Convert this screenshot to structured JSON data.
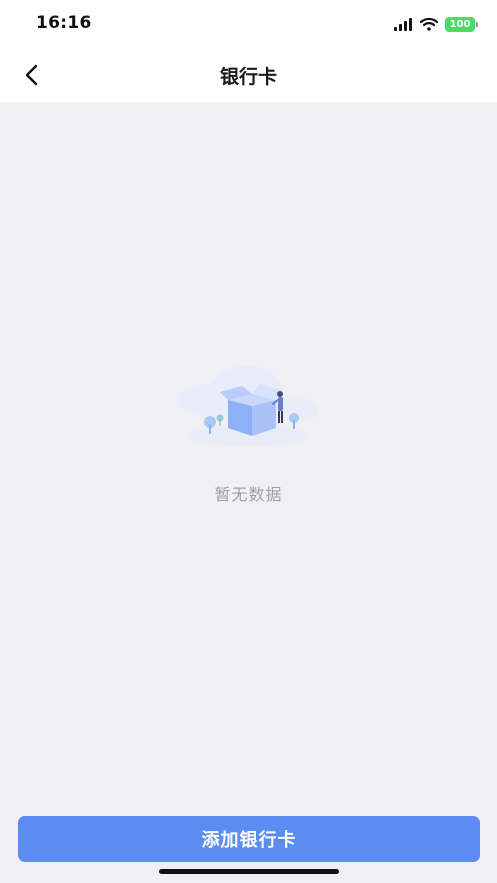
{
  "status_bar": {
    "time": "16:16",
    "battery_level": "100",
    "icons": [
      "signal-icon",
      "wifi-icon",
      "battery-icon"
    ],
    "battery_color": "#4cd964"
  },
  "nav": {
    "title": "银行卡",
    "back_icon": "chevron-left-icon"
  },
  "content": {
    "empty_icon": "empty-box-icon",
    "empty_text": "暂无数据",
    "background": "#efeff4"
  },
  "footer": {
    "add_button_label": "添加银行卡",
    "button_color": "#5b8cf1"
  }
}
